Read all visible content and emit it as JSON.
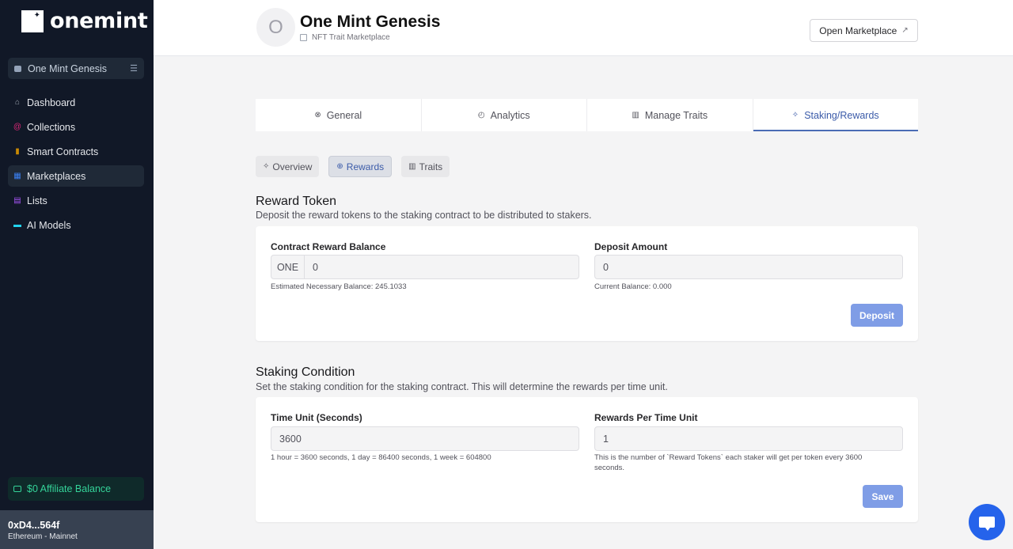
{
  "sidebar": {
    "brand": "onemint",
    "project_selector": "One Mint Genesis",
    "items": [
      {
        "label": "Dashboard",
        "icon": "home-icon",
        "color": "#9ca3af",
        "glyph": "⌂"
      },
      {
        "label": "Collections",
        "icon": "collections-icon",
        "color": "#db2777",
        "glyph": "@"
      },
      {
        "label": "Smart Contracts",
        "icon": "contract-icon",
        "color": "#ca8a04",
        "glyph": "▮"
      },
      {
        "label": "Marketplaces",
        "icon": "store-icon",
        "color": "#3b82f6",
        "glyph": "▦"
      },
      {
        "label": "Lists",
        "icon": "list-icon",
        "color": "#a855f7",
        "glyph": "▤"
      },
      {
        "label": "AI Models",
        "icon": "monitor-icon",
        "color": "#22d3ee",
        "glyph": "▬"
      }
    ],
    "active_item": "Marketplaces",
    "affiliate_balance": "$0 Affiliate Balance",
    "wallet_address": "0xD4...564f",
    "wallet_network": "Ethereum - Mainnet"
  },
  "header": {
    "avatar_letter": "O",
    "title": "One Mint Genesis",
    "subtitle": "NFT Trait Marketplace",
    "open_button": "Open Marketplace"
  },
  "tabs": [
    {
      "label": "General",
      "glyph": "⊗",
      "active": false
    },
    {
      "label": "Analytics",
      "glyph": "◴",
      "active": false
    },
    {
      "label": "Manage Traits",
      "glyph": "▥",
      "active": false
    },
    {
      "label": "Staking/Rewards",
      "glyph": "✧",
      "active": true
    }
  ],
  "subtabs": [
    {
      "label": "Overview",
      "glyph": "✧",
      "active": false
    },
    {
      "label": "Rewards",
      "glyph": "⊕",
      "active": true
    },
    {
      "label": "Traits",
      "glyph": "▥",
      "active": false
    }
  ],
  "reward_token": {
    "title": "Reward Token",
    "description": "Deposit the reward tokens to the staking contract to be distributed to stakers.",
    "contract_balance_label": "Contract Reward Balance",
    "currency_prefix": "ONE",
    "contract_balance_value": "0",
    "estimated_hint": "Estimated Necessary Balance: 245.1033",
    "deposit_label": "Deposit Amount",
    "deposit_value": "0",
    "current_balance_hint": "Current Balance: 0.000",
    "deposit_button": "Deposit"
  },
  "staking_condition": {
    "title": "Staking Condition",
    "description": "Set the staking condition for the staking contract. This will determine the rewards per time unit.",
    "time_unit_label": "Time Unit (Seconds)",
    "time_unit_value": "3600",
    "time_unit_hint": "1 hour = 3600 seconds, 1 day = 86400 seconds, 1 week = 604800",
    "rewards_label": "Rewards Per Time Unit",
    "rewards_value": "1",
    "rewards_hint": "This is the number of `Reward Tokens` each staker will get per token every 3600 seconds.",
    "save_button": "Save"
  },
  "colors": {
    "sidebar_bg": "#111827",
    "accent": "#3b5ba9",
    "primary_button": "#7f9de6",
    "chat_button": "#2563eb"
  }
}
